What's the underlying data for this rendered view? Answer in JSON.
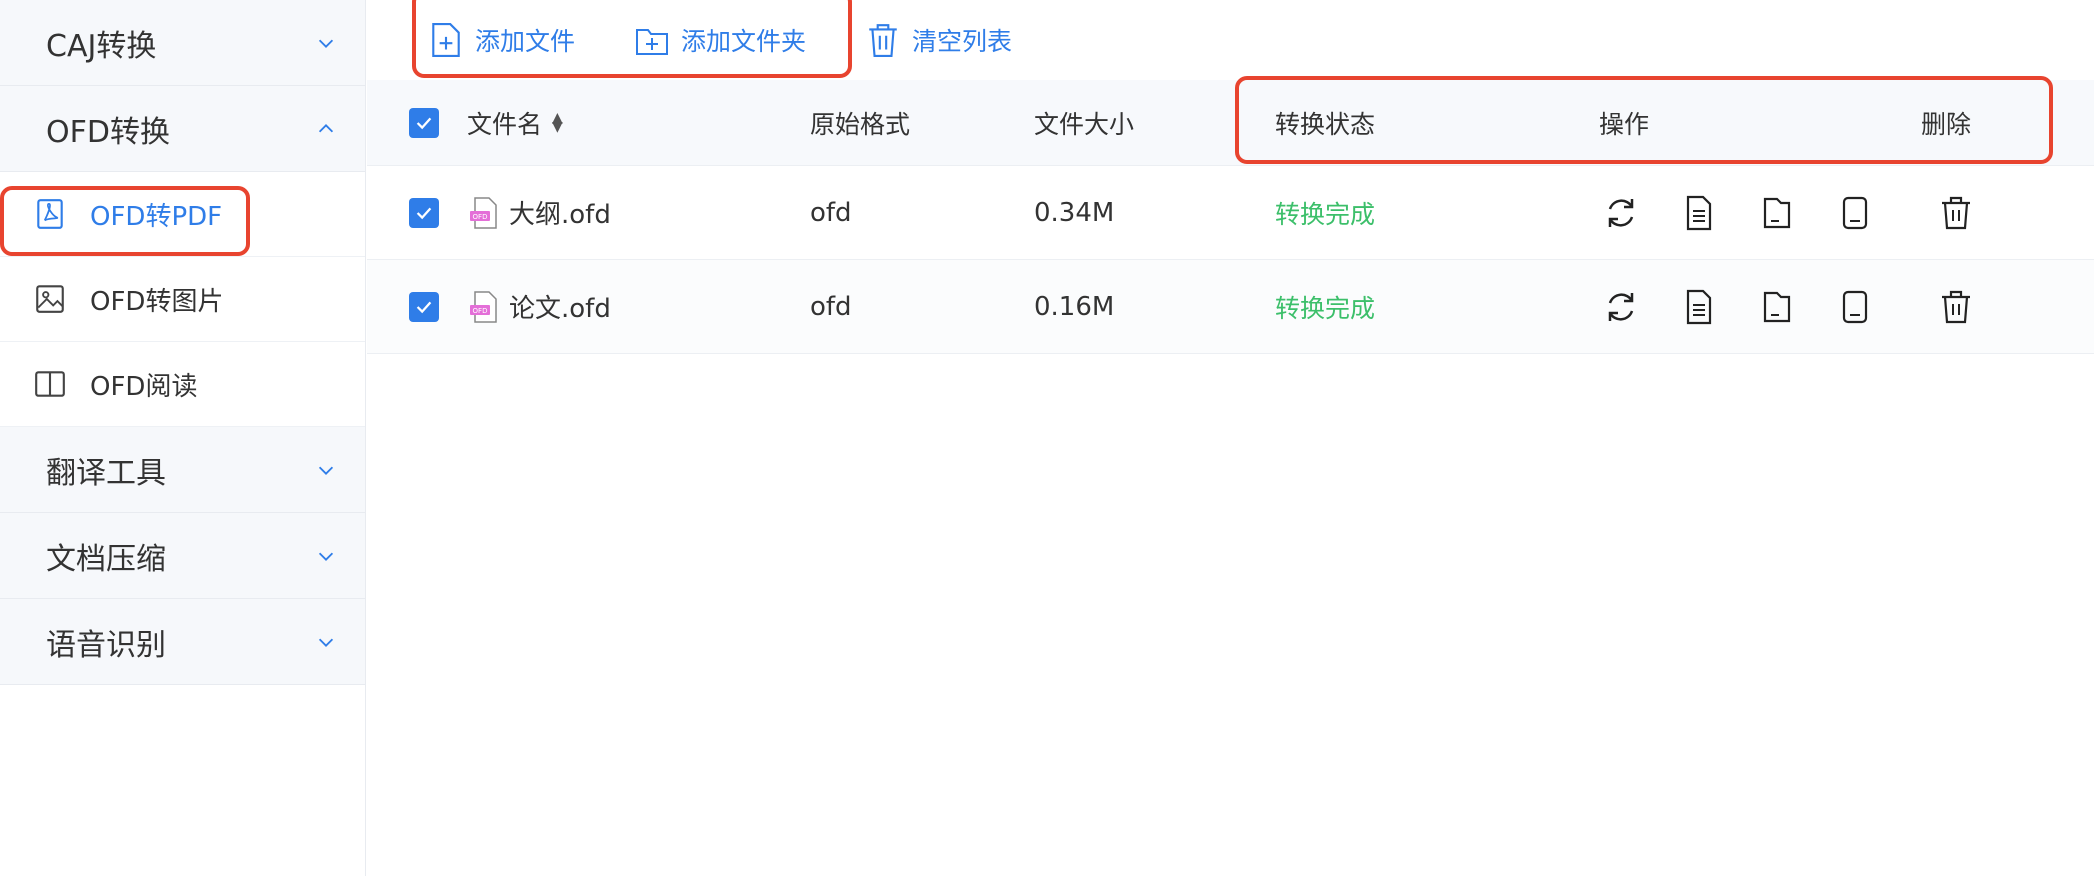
{
  "sidebar": {
    "groups": [
      {
        "label": "CAJ转换"
      },
      {
        "label": "OFD转换"
      },
      {
        "label": "翻译工具"
      },
      {
        "label": "文档压缩"
      },
      {
        "label": "语音识别"
      }
    ],
    "sub_items": [
      {
        "label": "OFD转PDF",
        "icon": "pdf-icon",
        "active": true
      },
      {
        "label": "OFD转图片",
        "icon": "image-icon"
      },
      {
        "label": "OFD阅读",
        "icon": "book-icon"
      }
    ]
  },
  "toolbar": {
    "add_file": "添加文件",
    "add_folder": "添加文件夹",
    "clear_list": "清空列表"
  },
  "table": {
    "headers": {
      "name": "文件名",
      "format": "原始格式",
      "size": "文件大小",
      "status": "转换状态",
      "ops": "操作",
      "delete": "删除"
    },
    "rows": [
      {
        "name": "大纲.ofd",
        "format": "ofd",
        "size": "0.34M",
        "status": "转换完成"
      },
      {
        "name": "论文.ofd",
        "format": "ofd",
        "size": "0.16M",
        "status": "转换完成"
      }
    ]
  },
  "colors": {
    "accent": "#2f7de8",
    "success": "#3cbf6a",
    "annotation": "#e8442f"
  }
}
